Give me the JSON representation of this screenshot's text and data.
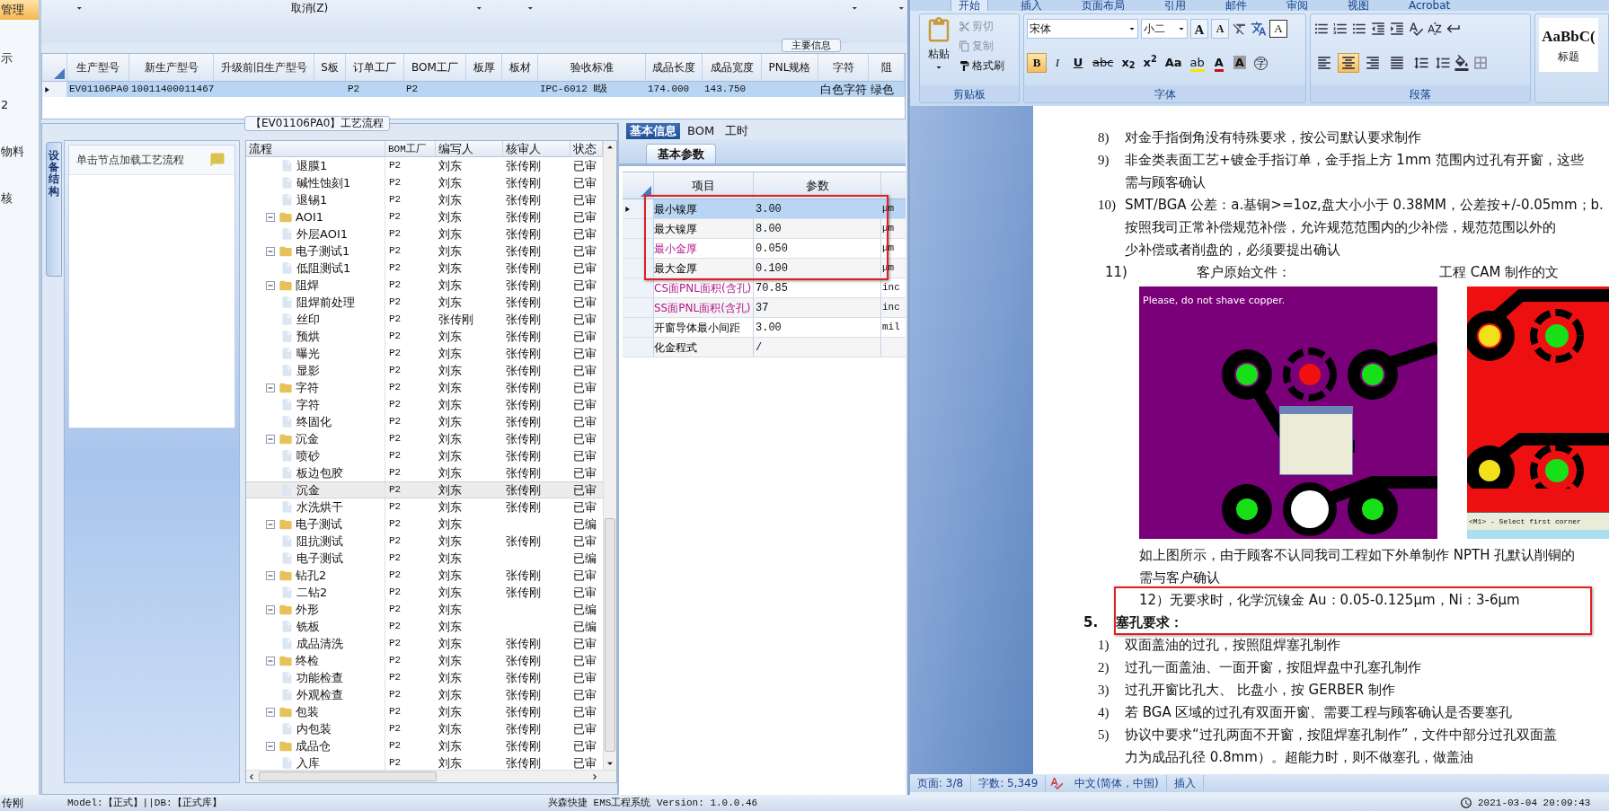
{
  "sidebar": {
    "items": [
      {
        "label": "管理",
        "selected": true
      },
      {
        "label": "示",
        "selected": false
      },
      {
        "label": "2",
        "selected": false
      },
      {
        "label": "物料",
        "selected": false
      },
      {
        "label": "核",
        "selected": false
      }
    ]
  },
  "toolbar": {
    "cancel_label": "取消(Z)"
  },
  "main_info": {
    "title": "主要信息",
    "columns": [
      "生产型号",
      "新生产型号",
      "升级前旧生产型号",
      "S板",
      "订单工厂",
      "BOM工厂",
      "板厚",
      "板材",
      "验收标准",
      "成品长度",
      "成品宽度",
      "PNL规格",
      "字符",
      "阻"
    ],
    "rows": [
      {
        "selected": true,
        "cells": [
          "EV01106PA0",
          "10011400011467",
          null,
          null,
          "P2",
          "P2",
          null,
          null,
          "IPC-6012 Ⅱ级",
          "174.000",
          "143.750",
          null,
          "白色字符",
          "绿色"
        ]
      }
    ]
  },
  "flow": {
    "title": "【EV01106PA0】工艺流程",
    "side_tab": "设备结构",
    "hint": "单击节点加载工艺流程",
    "columns": [
      "流程",
      "BOM工厂",
      "编写人",
      "核审人",
      "状态"
    ],
    "leading_rows": [
      {
        "kind": "step",
        "name": "退膜1",
        "bom": "P2",
        "writer": "刘东",
        "reviewer": "张传刚",
        "status": "已审",
        "selected": false
      },
      {
        "kind": "step",
        "name": "碱性蚀刻1",
        "bom": "P2",
        "writer": "刘东",
        "reviewer": "张传刚",
        "status": "已审",
        "selected": false
      },
      {
        "kind": "step",
        "name": "退锡1",
        "bom": "P2",
        "writer": "刘东",
        "reviewer": "张传刚",
        "status": "已审",
        "selected": false
      }
    ],
    "nodes": [
      {
        "kind": "folder",
        "name": "AOI1",
        "bom": "P2",
        "writer": "刘东",
        "reviewer": "张传刚",
        "status": "已审",
        "selected": false,
        "expanded": true,
        "children": [
          {
            "kind": "step",
            "name": "外层AOI1",
            "bom": "P2",
            "writer": "刘东",
            "reviewer": "张传刚",
            "status": "已审",
            "selected": false
          }
        ]
      },
      {
        "kind": "folder",
        "name": "电子测试1",
        "bom": "P2",
        "writer": "刘东",
        "reviewer": "张传刚",
        "status": "已审",
        "selected": false,
        "expanded": true,
        "children": [
          {
            "kind": "step",
            "name": "低阻测试1",
            "bom": "P2",
            "writer": "刘东",
            "reviewer": "张传刚",
            "status": "已审",
            "selected": false
          }
        ]
      },
      {
        "kind": "folder",
        "name": "阻焊",
        "bom": "P2",
        "writer": "刘东",
        "reviewer": "张传刚",
        "status": "已审",
        "selected": false,
        "expanded": true,
        "children": [
          {
            "kind": "step",
            "name": "阻焊前处理",
            "bom": "P2",
            "writer": "刘东",
            "reviewer": "张传刚",
            "status": "已审",
            "selected": false
          },
          {
            "kind": "step",
            "name": "丝印",
            "bom": "P2",
            "writer": "张传刚",
            "reviewer": "张传刚",
            "status": "已审",
            "selected": false
          },
          {
            "kind": "step",
            "name": "预烘",
            "bom": "P2",
            "writer": "刘东",
            "reviewer": "张传刚",
            "status": "已审",
            "selected": false
          },
          {
            "kind": "step",
            "name": "曝光",
            "bom": "P2",
            "writer": "刘东",
            "reviewer": "张传刚",
            "status": "已审",
            "selected": false
          },
          {
            "kind": "step",
            "name": "显影",
            "bom": "P2",
            "writer": "刘东",
            "reviewer": "张传刚",
            "status": "已审",
            "selected": false
          }
        ]
      },
      {
        "kind": "folder",
        "name": "字符",
        "bom": "P2",
        "writer": "刘东",
        "reviewer": "张传刚",
        "status": "已审",
        "selected": false,
        "expanded": true,
        "children": [
          {
            "kind": "step",
            "name": "字符",
            "bom": "P2",
            "writer": "刘东",
            "reviewer": "张传刚",
            "status": "已审",
            "selected": false
          },
          {
            "kind": "step",
            "name": "终固化",
            "bom": "P2",
            "writer": "刘东",
            "reviewer": "张传刚",
            "status": "已审",
            "selected": false
          }
        ]
      },
      {
        "kind": "folder",
        "name": "沉金",
        "bom": "P2",
        "writer": "刘东",
        "reviewer": "张传刚",
        "status": "已审",
        "selected": false,
        "expanded": true,
        "children": [
          {
            "kind": "step",
            "name": "喷砂",
            "bom": "P2",
            "writer": "刘东",
            "reviewer": "张传刚",
            "status": "已审",
            "selected": false
          },
          {
            "kind": "step",
            "name": "板边包胶",
            "bom": "P2",
            "writer": "刘东",
            "reviewer": "张传刚",
            "status": "已审",
            "selected": false
          },
          {
            "kind": "step",
            "name": "沉金",
            "bom": "P2",
            "writer": "刘东",
            "reviewer": "张传刚",
            "status": "已审",
            "selected": true
          },
          {
            "kind": "step",
            "name": "水洗烘干",
            "bom": "P2",
            "writer": "刘东",
            "reviewer": "张传刚",
            "status": "已审",
            "selected": false
          }
        ]
      },
      {
        "kind": "folder",
        "name": "电子测试",
        "bom": "P2",
        "writer": "刘东",
        "status": "已编",
        "selected": false,
        "expanded": true,
        "children": [
          {
            "kind": "step",
            "name": "阻抗测试",
            "bom": "P2",
            "writer": "刘东",
            "reviewer": "张传刚",
            "status": "已审",
            "selected": false
          },
          {
            "kind": "step",
            "name": "电子测试",
            "bom": "P2",
            "writer": "刘东",
            "status": "已编",
            "selected": false
          }
        ]
      },
      {
        "kind": "folder",
        "name": "钻孔2",
        "bom": "P2",
        "writer": "刘东",
        "reviewer": "张传刚",
        "status": "已审",
        "selected": false,
        "expanded": true,
        "children": [
          {
            "kind": "step",
            "name": "二钻2",
            "bom": "P2",
            "writer": "刘东",
            "reviewer": "张传刚",
            "status": "已审",
            "selected": false
          }
        ]
      },
      {
        "kind": "folder",
        "name": "外形",
        "bom": "P2",
        "writer": "刘东",
        "status": "已编",
        "selected": false,
        "expanded": true,
        "children": [
          {
            "kind": "step",
            "name": "铣板",
            "bom": "P2",
            "writer": "刘东",
            "status": "已编",
            "selected": false
          },
          {
            "kind": "step",
            "name": "成品清洗",
            "bom": "P2",
            "writer": "刘东",
            "reviewer": "张传刚",
            "status": "已审",
            "selected": false
          }
        ]
      },
      {
        "kind": "folder",
        "name": "终检",
        "bom": "P2",
        "writer": "刘东",
        "reviewer": "张传刚",
        "status": "已审",
        "selected": false,
        "expanded": true,
        "children": [
          {
            "kind": "step",
            "name": "功能检查",
            "bom": "P2",
            "writer": "刘东",
            "reviewer": "张传刚",
            "status": "已审",
            "selected": false
          },
          {
            "kind": "step",
            "name": "外观检查",
            "bom": "P2",
            "writer": "刘东",
            "reviewer": "张传刚",
            "status": "已审",
            "selected": false
          }
        ]
      },
      {
        "kind": "folder",
        "name": "包装",
        "bom": "P2",
        "writer": "刘东",
        "reviewer": "张传刚",
        "status": "已审",
        "selected": false,
        "expanded": true,
        "children": [
          {
            "kind": "step",
            "name": "内包装",
            "bom": "P2",
            "writer": "刘东",
            "reviewer": "张传刚",
            "status": "已审",
            "selected": false
          }
        ]
      },
      {
        "kind": "folder",
        "name": "成品仓",
        "bom": "P2",
        "writer": "刘东",
        "reviewer": "张传刚",
        "status": "已审",
        "selected": false,
        "expanded": true,
        "children": [
          {
            "kind": "step",
            "name": "入库",
            "bom": "P2",
            "writer": "刘东",
            "reviewer": "张传刚",
            "status": "已审",
            "selected": false
          }
        ]
      }
    ]
  },
  "detail": {
    "tabs": [
      {
        "label": "基本信息",
        "selected": true
      },
      {
        "label": "BOM",
        "selected": false
      },
      {
        "label": "工时",
        "selected": false
      }
    ],
    "subtabs": [
      {
        "label": "基本参数",
        "selected": true
      }
    ],
    "columns": [
      "项目",
      "参数"
    ],
    "rows": [
      {
        "item": "最小镍厚",
        "value": "3.00",
        "unit": "μm",
        "emphasized": false,
        "selected": true
      },
      {
        "item": "最大镍厚",
        "value": "8.00",
        "unit": "μm",
        "emphasized": false,
        "selected": false
      },
      {
        "item": "最小金厚",
        "value": "0.050",
        "unit": "μm",
        "emphasized": true,
        "selected": false
      },
      {
        "item": "最大金厚",
        "value": "0.100",
        "unit": "μm",
        "emphasized": false,
        "selected": false
      },
      {
        "item": "CS面PNL面积(含孔)",
        "value": "70.85",
        "unit": "inc",
        "emphasized": true,
        "selected": false
      },
      {
        "item": "SS面PNL面积(含孔)",
        "value": "37",
        "unit": "inc",
        "emphasized": true,
        "selected": false
      },
      {
        "item": "开窗导体最小间距",
        "value": "3.00",
        "unit": "mil",
        "emphasized": false,
        "selected": false
      },
      {
        "item": "化金程式",
        "value": "/",
        "emphasized": false,
        "selected": false
      }
    ]
  },
  "word": {
    "tabs": [
      {
        "label": "开始",
        "selected": true
      },
      {
        "label": "插入",
        "selected": false
      },
      {
        "label": "页面布局",
        "selected": false
      },
      {
        "label": "引用",
        "selected": false
      },
      {
        "label": "邮件",
        "selected": false
      },
      {
        "label": "审阅",
        "selected": false
      },
      {
        "label": "视图",
        "selected": false
      },
      {
        "label": "Acrobat",
        "selected": false
      }
    ],
    "clipboard": {
      "paste": "粘贴",
      "actions": [
        "剪切",
        "复制",
        "格式刷"
      ],
      "label": "剪贴板"
    },
    "font": {
      "family": "宋体",
      "size": "小二",
      "label": "字体",
      "size_buttons": [
        "A",
        "A"
      ],
      "border_button": "A",
      "format_buttons": [
        {
          "kind": "bold",
          "label": "B",
          "selected": true
        },
        {
          "kind": "italic",
          "label": "I",
          "selected": false
        },
        {
          "kind": "underline",
          "label": "U",
          "selected": false
        },
        {
          "kind": "strike",
          "label": "abc",
          "selected": false
        },
        {
          "kind": "plain",
          "label": "x$_{2}$",
          "selected": false
        },
        {
          "kind": "plain",
          "label": "x$^{2}$",
          "selected": false
        },
        {
          "kind": "plain",
          "label": "Aa",
          "selected": false
        },
        {
          "kind": "highlight",
          "label": "ab",
          "selected": false
        },
        {
          "kind": "color",
          "label": "A",
          "selected": false
        },
        {
          "kind": "shade",
          "label": "A",
          "selected": false
        },
        {
          "kind": "enclose",
          "label": "字",
          "selected": false
        }
      ]
    },
    "paragraph": {
      "label": "段落",
      "align_buttons": [
        {
          "kind": "left",
          "selected": false
        },
        {
          "kind": "center",
          "selected": true
        },
        {
          "kind": "right",
          "selected": false
        },
        {
          "kind": "justify",
          "selected": false
        },
        {
          "kind": "distributed",
          "selected": false
        }
      ]
    },
    "styles": {
      "sample": "AaBbC(",
      "name": "标题"
    },
    "document": [
      {
        "kind": "item",
        "number": "8)",
        "lines": [
          "对金手指倒角没有特殊要求，按公司默认要求制作"
        ]
      },
      {
        "kind": "item",
        "number": "9)",
        "lines": [
          "非金类表面工艺+镀金手指订单，金手指上方 1mm 范围内过孔有开窗，这些",
          "需与顾客确认"
        ]
      },
      {
        "kind": "item",
        "number": "10)",
        "lines": [
          "SMT/BGA 公差：a.基铜>=1oz,盘大小小于 0.38MM，公差按+/-0.05mm；b.",
          "按照我司正常补偿规范补偿，允许规范范围内的少补偿，规范范围以外的",
          "少补偿或者削盘的，必须要提出确认"
        ]
      },
      {
        "kind": "captions",
        "number": "11)",
        "lines": [
          "客户原始文件：",
          "工程 CAM 制作的文"
        ]
      },
      {
        "kind": "images",
        "lines": [
          "Please, do not shave copper.",
          "<M1> - Select first corner"
        ]
      },
      {
        "kind": "text",
        "lines": [
          "如上图所示，由于顾客不认同我司工程如下外单制作 NPTH 孔默认削铜的",
          "需与客户确认"
        ]
      },
      {
        "kind": "boxed",
        "lines": [
          "12）无要求时，化学沉镍金 Au：0.05-0.125μm，Ni：3-6μm"
        ]
      },
      {
        "kind": "heading",
        "number": "5.",
        "lines": [
          "塞孔要求："
        ]
      },
      {
        "kind": "item",
        "number": "1)",
        "lines": [
          "双面盖油的过孔，按照阻焊塞孔制作"
        ]
      },
      {
        "kind": "item",
        "number": "2)",
        "lines": [
          "过孔一面盖油、一面开窗，按阻焊盘中孔塞孔制作"
        ]
      },
      {
        "kind": "item",
        "number": "3)",
        "lines": [
          "过孔开窗比孔大、 比盘小，按 GERBER 制作"
        ]
      },
      {
        "kind": "item",
        "number": "4)",
        "lines": [
          "若 BGA 区域的过孔有双面开窗、需要工程与顾客确认是否要塞孔"
        ]
      },
      {
        "kind": "item",
        "number": "5)",
        "lines": [
          "协议中要求“过孔两面不开窗，按阻焊塞孔制作”，文件中部分过孔双面盖",
          "力为成品孔径 0.8mm）。超能力时，则不做塞孔，做盖油"
        ]
      }
    ],
    "status_bar": [
      "页面: 3/8",
      "字数: 5,349",
      "中文(简体，中国)",
      "插入"
    ]
  },
  "status_bar": {
    "user": "传刚",
    "model": "Model:【正式】||DB:【正式库】",
    "app": "兴森快捷 EMS工程系统 Version: 1.0.0.46",
    "time": "2021-03-04 20:09:43"
  }
}
